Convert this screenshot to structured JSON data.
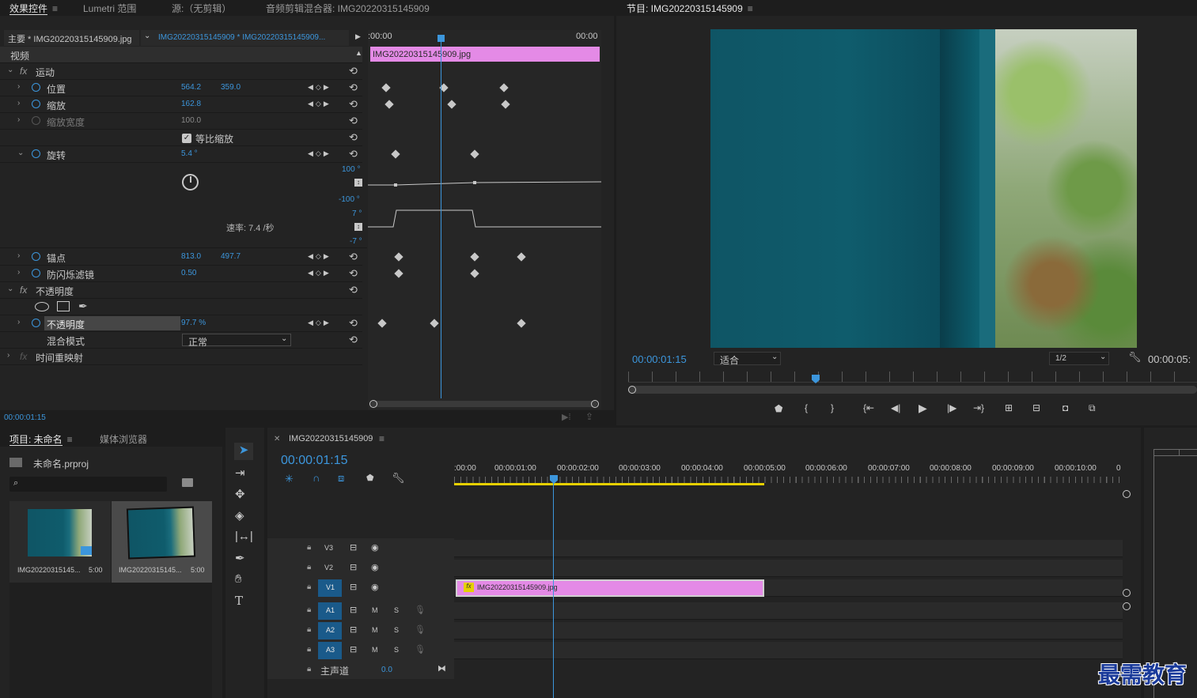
{
  "effect_controls": {
    "tabs": [
      "效果控件",
      "Lumetri 范围",
      "源:（无剪辑）",
      "音频剪辑混合器: IMG20220315145909"
    ],
    "breadcrumb_master": "主要 * IMG20220315145909.jpg",
    "breadcrumb_seq": "IMG20220315145909 * IMG20220315145909...",
    "section_video": "视频",
    "motion": "运动",
    "position": {
      "label": "位置",
      "x": "564.2",
      "y": "359.0"
    },
    "scale": {
      "label": "缩放",
      "value": "162.8"
    },
    "scale_width": {
      "label": "缩放宽度",
      "value": "100.0"
    },
    "uniform_scale": "等比缩放",
    "rotation": {
      "label": "旋转",
      "value": "5.4 °"
    },
    "graph1_top": "100 °",
    "graph1_bottom": "-100 °",
    "graph2_top": "7 °",
    "graph2_bottom": "-7 °",
    "velocity": "速率: 7.4 /秒",
    "anchor": {
      "label": "锚点",
      "x": "813.0",
      "y": "497.7"
    },
    "anti_flicker": {
      "label": "防闪烁滤镜",
      "value": "0.50"
    },
    "opacity_group": "不透明度",
    "opacity": {
      "label": "不透明度",
      "value": "97.7 %"
    },
    "blend_mode": {
      "label": "混合模式",
      "value": "正常"
    },
    "time_remap": "时间重映射",
    "timecode": "00:00:01:15",
    "tl_start": ":00:00",
    "tl_end": "00:00",
    "clip_name": "IMG20220315145909.jpg"
  },
  "program_monitor": {
    "title": "节目: IMG20220315145909",
    "timecode": "00:00:01:15",
    "fit": "适合",
    "resolution": "1/2",
    "duration": "00:00:05:"
  },
  "project": {
    "tabs": [
      "项目: 未命名",
      "媒体浏览器"
    ],
    "file": "未命名.prproj",
    "items": [
      {
        "name": "IMG20220315145...",
        "duration": "5:00"
      },
      {
        "name": "IMG20220315145...",
        "duration": "5:00"
      }
    ]
  },
  "timeline": {
    "tab": "IMG20220315145909",
    "timecode": "00:00:01:15",
    "ruler": [
      ":00:00",
      "00:00:01:00",
      "00:00:02:00",
      "00:00:03:00",
      "00:00:04:00",
      "00:00:05:00",
      "00:00:06:00",
      "00:00:07:00",
      "00:00:08:00",
      "00:00:09:00",
      "00:00:10:00",
      "0"
    ],
    "video_tracks": [
      "V3",
      "V2",
      "V1"
    ],
    "audio_tracks": [
      "A1",
      "A2",
      "A3"
    ],
    "mute": "M",
    "solo": "S",
    "master": "主声道",
    "master_value": "0.0",
    "clip_name": "IMG20220315145909.jpg",
    "clip_fx": "fx"
  },
  "watermark": "最需教育",
  "colors": {
    "accent": "#3c96dc",
    "clip": "#e48ae6",
    "work_area": "#e6d000"
  }
}
